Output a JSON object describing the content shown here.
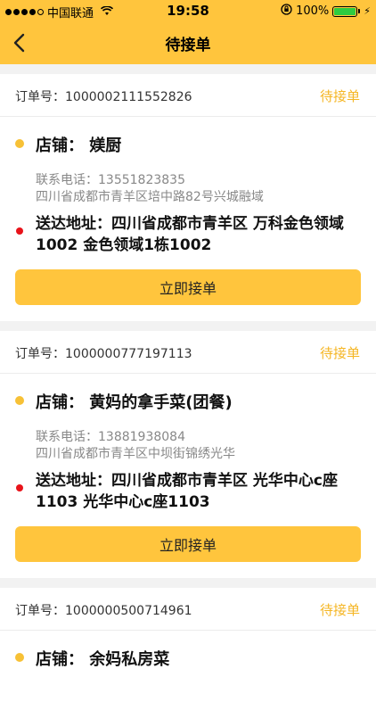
{
  "status_bar": {
    "carrier": "中国联通",
    "time": "19:58",
    "battery": "100%"
  },
  "nav": {
    "title": "待接单"
  },
  "orders": [
    {
      "order_label": "订单号：1000002111552826",
      "status": "待接单",
      "shop": "店铺：  媄厨",
      "phone": "联系电话：13551823835",
      "shop_address": "四川省成都市青羊区培中路82号兴城融域",
      "delivery": "送达地址：四川省成都市青羊区 万科金色领域1002 金色领域1栋1002",
      "button": "立即接单"
    },
    {
      "order_label": "订单号：1000000777197113",
      "status": "待接单",
      "shop": "店铺：  黄妈的拿手菜(团餐)",
      "phone": "联系电话：13881938084",
      "shop_address": "四川省成都市青羊区中坝街锦绣光华",
      "delivery": "送达地址：四川省成都市青羊区 光华中心c座1103 光华中心c座1103",
      "button": "立即接单"
    },
    {
      "order_label": "订单号：1000000500714961",
      "status": "待接单",
      "shop": "店铺：  余妈私房菜"
    }
  ]
}
